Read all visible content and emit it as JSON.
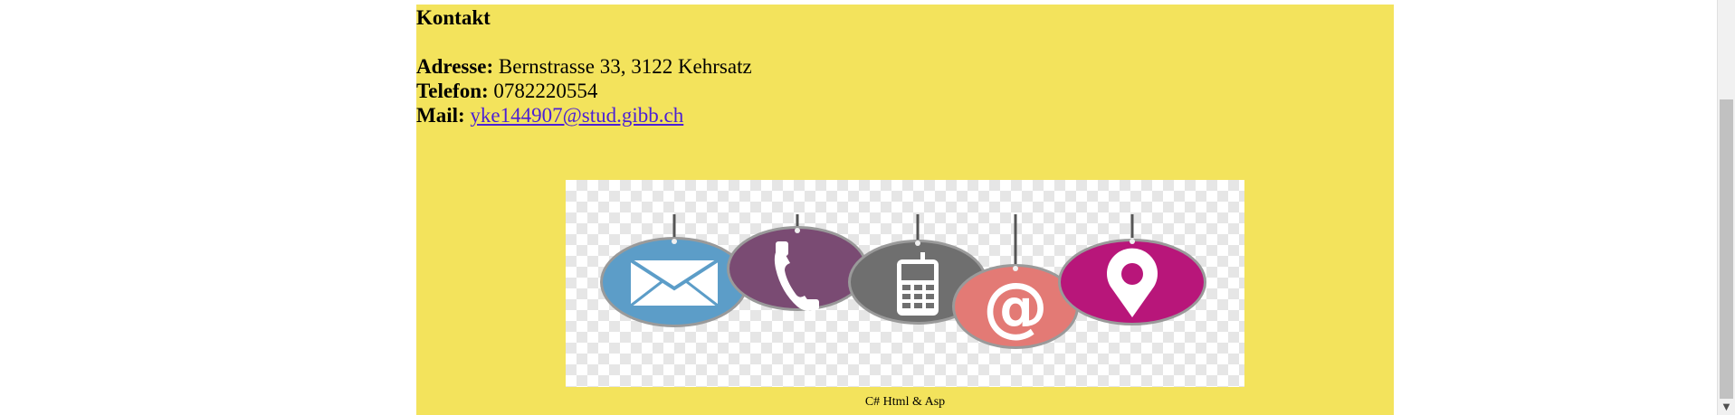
{
  "contact": {
    "heading": "Kontakt",
    "address_label": "Adresse:",
    "address_value": "Bernstrasse 33, 3122 Kehrsatz",
    "phone_label": "Telefon:",
    "phone_value": "0782220554",
    "mail_label": "Mail:",
    "mail_value": "yke144907@stud.gibb.ch"
  },
  "image": {
    "icons": [
      "envelope-icon",
      "phone-icon",
      "mobile-phone-icon",
      "at-sign-icon",
      "location-pin-icon"
    ],
    "colors": {
      "envelope": "#5c9dc8",
      "phone": "#7a4b73",
      "mobile": "#6f6f6f",
      "at": "#e37a75",
      "pin": "#b8167a"
    }
  },
  "footer": {
    "text": "C# Html & Asp"
  },
  "colors": {
    "panel_background": "#f3e35c",
    "link": "#4b1fd6"
  }
}
